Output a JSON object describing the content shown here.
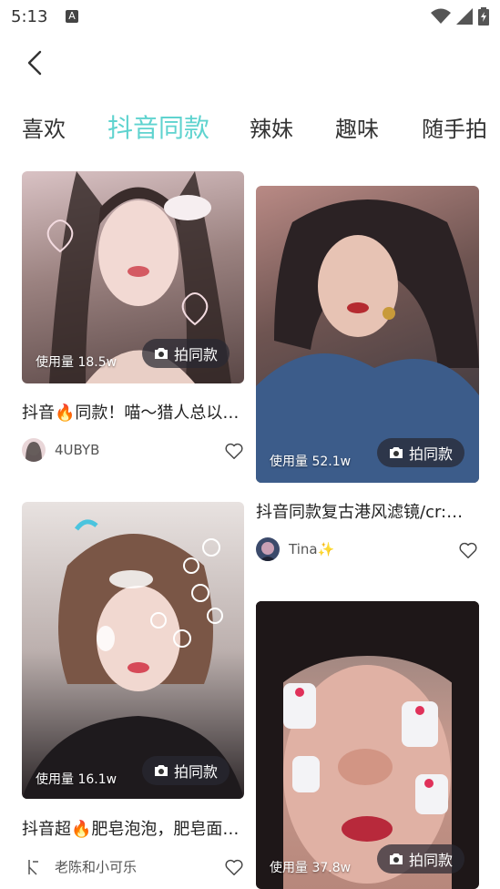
{
  "status": {
    "time": "5:13",
    "notice_glyph": "A"
  },
  "tabs": [
    {
      "label": "喜欢"
    },
    {
      "label": "抖音同款"
    },
    {
      "label": "辣妹"
    },
    {
      "label": "趣味"
    },
    {
      "label": "随手拍"
    }
  ],
  "shoot_label": "拍同款",
  "cards": [
    {
      "usage": "使用量 18.5w",
      "title": "抖音🔥同款！喵～猎人总以…",
      "author": "4UBYB"
    },
    {
      "usage": "使用量 52.1w",
      "title": "抖音同款复古港风滤镜/cr:…",
      "author": "Tina✨"
    },
    {
      "usage": "使用量 16.1w",
      "title": "抖音超🔥肥皂泡泡，肥皂面…",
      "author": "老陈和小可乐"
    },
    {
      "usage": "使用量 37.8w"
    }
  ],
  "colors": {
    "accent": "#5fd3cf"
  }
}
